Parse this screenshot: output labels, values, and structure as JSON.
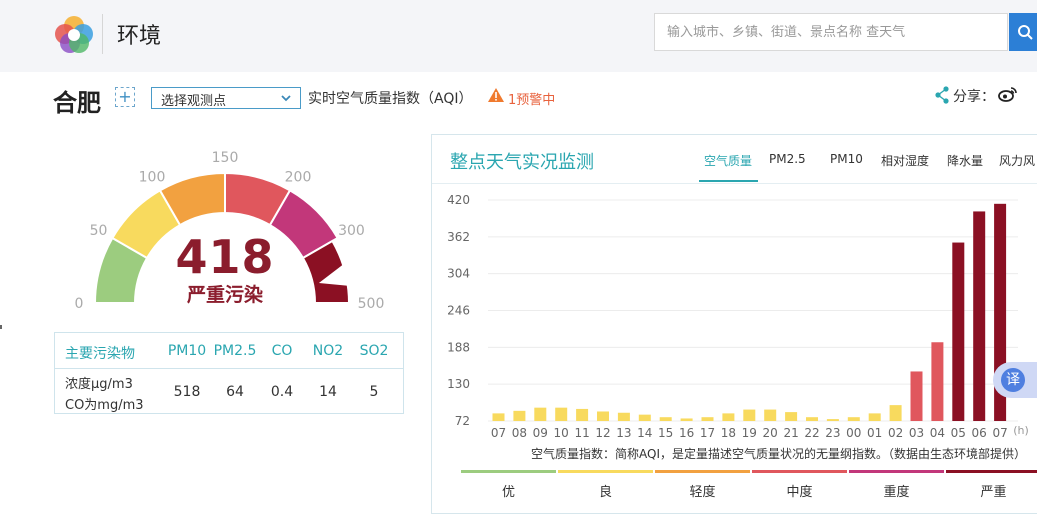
{
  "header": {
    "title": "环境",
    "search_placeholder": "输入城市、乡镇、街道、景点名称 查天气"
  },
  "city_bar": {
    "city": "合肥",
    "add_label": "+",
    "station_select": "选择观测点",
    "aqi_caption": "实时空气质量指数（AQI）",
    "warning": "1预警中",
    "share_label": "分享："
  },
  "gauge": {
    "value": "418",
    "level": "严重污染",
    "ticks": [
      "0",
      "50",
      "100",
      "150",
      "200",
      "300",
      "500"
    ],
    "segment_colors": [
      "#9ccc7f",
      "#f8da5e",
      "#f2a140",
      "#e0575d",
      "#c2377a",
      "#8b1023"
    ]
  },
  "pollutants": {
    "header_label": "主要污染物",
    "names": [
      "PM10",
      "PM2.5",
      "CO",
      "NO2",
      "SO2"
    ],
    "row_label_1": "浓度μg/m3",
    "row_label_2": "CO为mg/m3",
    "values": [
      "518",
      "64",
      "0.4",
      "14",
      "5"
    ]
  },
  "monitor": {
    "title": "整点天气实况监测",
    "tabs": [
      "空气质量",
      "PM2.5",
      "PM10",
      "相对湿度",
      "降水量",
      "风力风"
    ],
    "active_tab": 0,
    "note": "空气质量指数：简称AQI，是定量描述空气质量状况的无量纲指数。（数据由生态环境部提供）",
    "legend": [
      {
        "label": "优",
        "color": "#9ccc7f"
      },
      {
        "label": "良",
        "color": "#f8da5e"
      },
      {
        "label": "轻度",
        "color": "#f2a140"
      },
      {
        "label": "中度",
        "color": "#e0575d"
      },
      {
        "label": "重度",
        "color": "#c2377a"
      },
      {
        "label": "严重",
        "color": "#8b1023"
      }
    ]
  },
  "translate_label": "译",
  "chart_data": {
    "type": "bar",
    "x_unit": "(h)",
    "categories": [
      "07",
      "08",
      "09",
      "10",
      "11",
      "12",
      "13",
      "14",
      "15",
      "16",
      "17",
      "18",
      "19",
      "20",
      "21",
      "22",
      "23",
      "00",
      "01",
      "02",
      "03",
      "04",
      "05",
      "06",
      "07"
    ],
    "values": [
      84,
      88,
      93,
      93,
      91,
      87,
      85,
      82,
      78,
      76,
      78,
      84,
      90,
      90,
      86,
      78,
      75,
      78,
      84,
      97,
      150,
      196,
      353,
      402,
      414
    ],
    "y_ticks": [
      72,
      130,
      188,
      246,
      304,
      362,
      420
    ],
    "ylim": [
      72,
      420
    ],
    "grid": true,
    "bar_colors": [
      "#f8da5e",
      "#f8da5e",
      "#f8da5e",
      "#f8da5e",
      "#f8da5e",
      "#f8da5e",
      "#f8da5e",
      "#f8da5e",
      "#f8da5e",
      "#f8da5e",
      "#f8da5e",
      "#f8da5e",
      "#f8da5e",
      "#f8da5e",
      "#f8da5e",
      "#f8da5e",
      "#f8da5e",
      "#f8da5e",
      "#f8da5e",
      "#f8da5e",
      "#e0575d",
      "#e0575d",
      "#8b1023",
      "#8b1023",
      "#8b1023"
    ]
  }
}
